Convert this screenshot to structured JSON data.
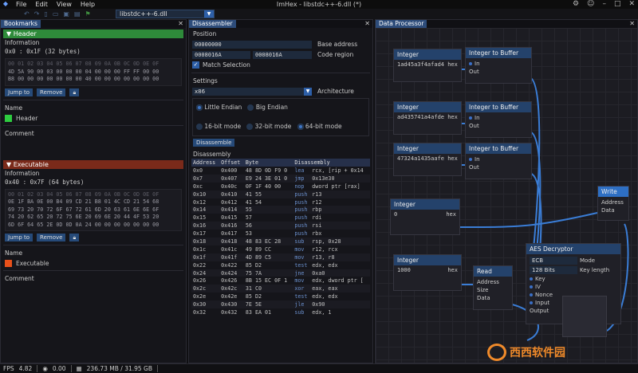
{
  "app": {
    "title": "ImHex - libstdc++-6.dll (*)"
  },
  "menu": [
    "File",
    "Edit",
    "View",
    "Help"
  ],
  "toolbar": {
    "file_selector": "libstdc++-6.dll"
  },
  "bookmarks": {
    "tab": "Bookmarks",
    "items": [
      {
        "name": "Header",
        "color": "#2e8b3a",
        "info_label": "Information",
        "range": "0x0 : 0x1F (32 bytes)",
        "hex_header": "00 01 02 03 04 05 06 07 08 09 0A 0B 0C 0D 0E 0F",
        "hex_rows": [
          "4D 5A 90 00 03 00 00 00 04 00 00 00 FF FF 00 00",
          "B8 00 00 00 00 00 00 00 40 00 00 00 00 00 00 00"
        ],
        "jump": "Jump to",
        "remove": "Remove",
        "name_label": "Name",
        "name_value": "Header",
        "comment_label": "Comment",
        "swatch": "#2ecc40"
      },
      {
        "name": "Executable",
        "color": "#7a2a1a",
        "info_label": "Information",
        "range": "0x40 : 0x7F (64 bytes)",
        "hex_header": "00 01 02 03 04 05 06 07 08 09 0A 0B 0C 0D 0E 0F",
        "hex_rows": [
          "0E 1F BA 0E 00 B4 09 CD 21 B8 01 4C CD 21 54 68",
          "69 73 20 70 72 6F 67 72 61 6D 20 63 61 6E 6E 6F",
          "74 20 62 65 20 72 75 6E 20 69 6E 20 44 4F 53 20",
          "6D 6F 64 65 2E 0D 0D 0A 24 00 00 00 00 00 00 00"
        ],
        "jump": "Jump to",
        "remove": "Remove",
        "name_label": "Name",
        "name_value": "Executable",
        "comment_label": "Comment",
        "swatch": "#e8501a"
      }
    ]
  },
  "disassembler": {
    "tab": "Disassembler",
    "position_label": "Position",
    "base_address": "00000000",
    "base_label": "Base address",
    "region_start": "0008016A",
    "region_end": "0008016A",
    "region_label": "Code region",
    "match_label": "Match Selection",
    "settings_label": "Settings",
    "arch": "x86",
    "arch_label": "Architecture",
    "little": "Little Endian",
    "big": "Big Endian",
    "m16": "16-bit mode",
    "m32": "32-bit mode",
    "m64": "64-bit mode",
    "disassemble": "Disassemble",
    "dis_label": "Disassembly",
    "columns": [
      "Address",
      "Offset",
      "Byte",
      "Disassembly"
    ],
    "rows": [
      [
        "0x0",
        "0x400",
        "48 8D 0D F9 0",
        "lea",
        "rcx, [rip + 0x14"
      ],
      [
        "0x7",
        "0x407",
        "E9 24 3E 01 0",
        "jmp",
        "0x13e30"
      ],
      [
        "0xc",
        "0x40c",
        "0F 1F 40 00",
        "nop",
        "dword ptr [rax]"
      ],
      [
        "0x10",
        "0x410",
        "41 55",
        "push",
        "r13"
      ],
      [
        "0x12",
        "0x412",
        "41 54",
        "push",
        "r12"
      ],
      [
        "0x14",
        "0x414",
        "55",
        "push",
        "rbp"
      ],
      [
        "0x15",
        "0x415",
        "57",
        "push",
        "rdi"
      ],
      [
        "0x16",
        "0x416",
        "56",
        "push",
        "rsi"
      ],
      [
        "0x17",
        "0x417",
        "53",
        "push",
        "rbx"
      ],
      [
        "0x18",
        "0x418",
        "48 83 EC 28",
        "sub",
        "rsp, 0x28"
      ],
      [
        "0x1c",
        "0x41c",
        "49 89 CC",
        "mov",
        "r12, rcx"
      ],
      [
        "0x1f",
        "0x41f",
        "4D 89 C5",
        "mov",
        "r13, r8"
      ],
      [
        "0x22",
        "0x422",
        "85 D2",
        "test",
        "edx, edx"
      ],
      [
        "0x24",
        "0x424",
        "75 7A",
        "jne",
        "0xa0"
      ],
      [
        "0x26",
        "0x426",
        "8B 15 EC 0F 1",
        "mov",
        "edx, dword ptr ["
      ],
      [
        "0x2c",
        "0x42c",
        "31 C0",
        "xor",
        "eax, eax"
      ],
      [
        "0x2e",
        "0x42e",
        "85 D2",
        "test",
        "edx, edx"
      ],
      [
        "0x30",
        "0x430",
        "7E 5E",
        "jle",
        "0x90"
      ],
      [
        "0x32",
        "0x432",
        "83 EA 01",
        "sub",
        "edx, 1"
      ]
    ]
  },
  "data_processor": {
    "tab": "Data Processor",
    "nodes": {
      "int1": {
        "title": "Integer",
        "value": "1ad45a3f4afad4 hex"
      },
      "buf1": {
        "title": "Integer to Buffer",
        "in": "In",
        "out": "Out"
      },
      "int2": {
        "title": "Integer",
        "value": "ad435741a4afde hex"
      },
      "buf2": {
        "title": "Integer to Buffer",
        "in": "In",
        "out": "Out"
      },
      "int3": {
        "title": "Integer",
        "value": "47324a1435aafe hex"
      },
      "buf3": {
        "title": "Integer to Buffer",
        "in": "In",
        "out": "Out"
      },
      "int4": {
        "title": "Integer",
        "value": "0",
        "unit": "hex"
      },
      "int5": {
        "title": "Integer",
        "value": "1000",
        "unit": "hex"
      },
      "read": {
        "title": "Read",
        "p1": "Address",
        "p2": "Size",
        "p3": "Data"
      },
      "write": {
        "title": "Write",
        "p1": "Address",
        "p2": "Data"
      },
      "aes": {
        "title": "AES Decryptor",
        "mode": "ECB",
        "mode_label": "Mode",
        "keylen": "128 Bits",
        "keylen_label": "Key length",
        "inputs": [
          "Key",
          "IV",
          "Nonce",
          "Input"
        ],
        "output": "Output"
      }
    }
  },
  "status": {
    "fps_label": "FPS",
    "fps": "4.82",
    "cpu": "0.00",
    "mem": "236.73 MB / 31.95 GB"
  },
  "watermark": "西西软件园"
}
